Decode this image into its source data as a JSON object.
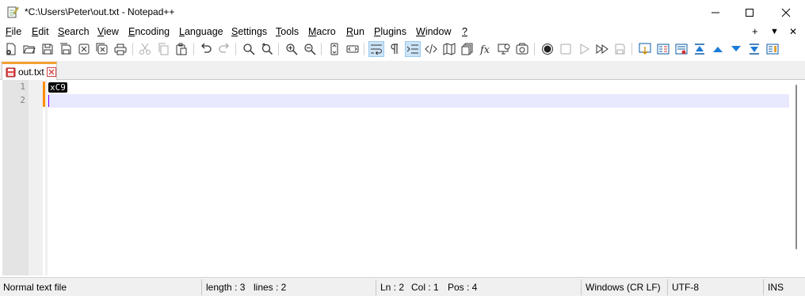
{
  "window": {
    "title": "*C:\\Users\\Peter\\out.txt - Notepad++",
    "icon": "notepad-plus-plus-icon"
  },
  "menu": {
    "items": [
      {
        "label": "File",
        "accel": "F",
        "rest": "ile"
      },
      {
        "label": "Edit",
        "accel": "E",
        "rest": "dit"
      },
      {
        "label": "Search",
        "accel": "S",
        "rest": "earch"
      },
      {
        "label": "View",
        "accel": "V",
        "rest": "iew"
      },
      {
        "label": "Encoding",
        "accel": "E",
        "rest": "ncoding"
      },
      {
        "label": "Language",
        "accel": "L",
        "rest": "anguage"
      },
      {
        "label": "Settings",
        "accel": "S",
        "rest": "ettings"
      },
      {
        "label": "Tools",
        "accel": "T",
        "rest": "ools"
      },
      {
        "label": "Macro",
        "accel": "M",
        "rest": "acro"
      },
      {
        "label": "Run",
        "accel": "R",
        "rest": "un"
      },
      {
        "label": "Plugins",
        "accel": "P",
        "rest": "lugins"
      },
      {
        "label": "Window",
        "accel": "W",
        "rest": "indow"
      },
      {
        "label": "?",
        "accel": "?",
        "rest": ""
      }
    ],
    "right_plus": "+",
    "right_down": "▼",
    "right_close": "✕"
  },
  "toolbar": {
    "icons": [
      "new-file-icon",
      "open-file-icon",
      "save-icon",
      "save-all-icon",
      "close-icon",
      "close-all-icon",
      "print-icon",
      "cut-icon",
      "copy-icon",
      "paste-icon",
      "undo-icon",
      "redo-icon",
      "find-icon",
      "replace-icon",
      "zoom-in-icon",
      "zoom-out-icon",
      "sync-vertical-icon",
      "sync-horizontal-icon",
      "word-wrap-icon",
      "show-all-characters-icon",
      "indent-guide-icon",
      "xml-tag-icon",
      "document-map-icon",
      "document-list-icon",
      "function-list-icon",
      "monitoring-icon",
      "folder-as-workspace-icon",
      "record-macro-icon",
      "stop-recording-icon",
      "play-macro-icon",
      "run-macro-multiple-icon",
      "save-macro-icon",
      "compare-icon",
      "compare-next-icon",
      "compare-prev-icon",
      "first-diff-icon",
      "prev-diff-icon",
      "next-diff-icon",
      "last-diff-icon",
      "nav-bar-icon"
    ]
  },
  "tab": {
    "label": "out.txt",
    "modified": true
  },
  "editor": {
    "lines": [
      "1",
      "2"
    ],
    "line1_control_char": "xC9"
  },
  "status": {
    "file_type": "Normal text file",
    "length": "length : 3",
    "lines": "lines : 2",
    "ln": "Ln : 2",
    "col": "Col : 1",
    "pos": "Pos : 4",
    "eol": "Windows (CR LF)",
    "encoding": "UTF-8",
    "mode": "INS"
  },
  "colors": {
    "tab_accent": "#f2a033",
    "current_line": "#e8e8ff",
    "caret": "#8000ff",
    "change_bar": "#ff8c00"
  }
}
